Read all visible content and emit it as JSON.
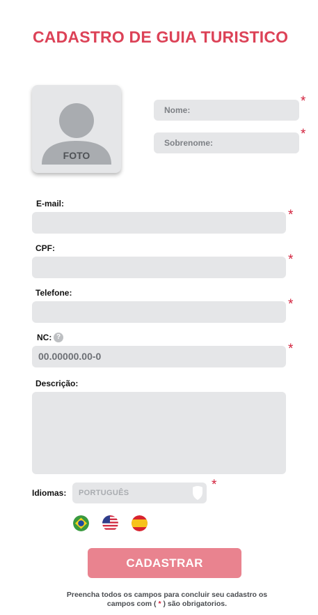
{
  "page": {
    "title": "CADASTRO DE GUIA TURISTICO"
  },
  "photo": {
    "label": "FOTO",
    "icon": "user-avatar-icon"
  },
  "form": {
    "required_mark": "*",
    "nome": {
      "placeholder": "Nome:"
    },
    "sobrenome": {
      "placeholder": "Sobrenome:"
    },
    "email": {
      "label": "E-mail:",
      "value": ""
    },
    "cpf": {
      "label": "CPF:",
      "value": ""
    },
    "telefone": {
      "label": "Telefone:",
      "value": ""
    },
    "nc": {
      "label": "NC:",
      "help_icon": "question-circle-icon",
      "help_glyph": "?",
      "value": "00.00000.00-0"
    },
    "descricao": {
      "label": "Descrição:",
      "value": ""
    },
    "idiomas": {
      "label": "Idiomas:",
      "selected": "PORTUGUÊS",
      "flags": [
        {
          "name": "brazil-flag-icon"
        },
        {
          "name": "usa-flag-icon"
        },
        {
          "name": "spain-flag-icon"
        }
      ]
    }
  },
  "submit": {
    "label": "CADASTRAR"
  },
  "footnote": {
    "line1": "Preencha todos os campos para concluir seu cadastro os",
    "line2_pre": "campos com ( ",
    "star": "*",
    "line2_post": " ) são obrigatorios."
  },
  "colors": {
    "accent": "#dc4257",
    "button": "#e9838f",
    "field_bg": "#e5e6e8",
    "required": "#d2213c"
  }
}
